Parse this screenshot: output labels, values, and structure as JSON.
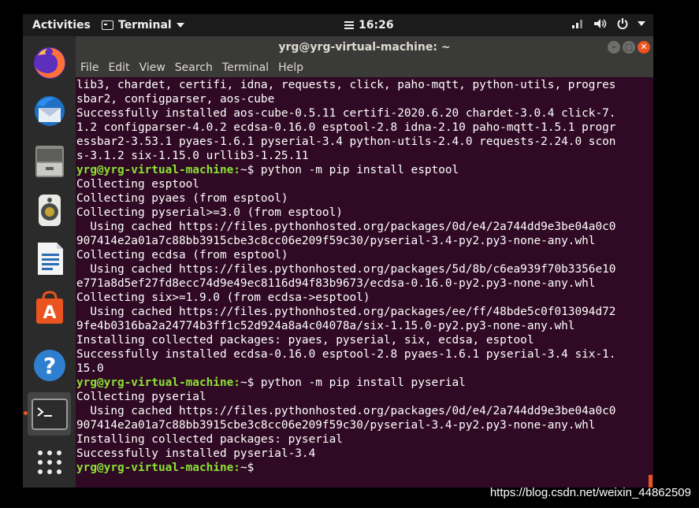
{
  "topbar": {
    "activities": "Activities",
    "app_name": "Terminal",
    "clock": "16:26"
  },
  "window": {
    "title": "yrg@yrg-virtual-machine: ~",
    "buttons": [
      "–",
      "▢",
      "✕"
    ]
  },
  "menubar": {
    "items": [
      "File",
      "Edit",
      "View",
      "Search",
      "Terminal",
      "Help"
    ]
  },
  "terminal": {
    "lines": [
      {
        "text": "lib3, chardet, certifi, idna, requests, click, paho-mqtt, python-utils, progres"
      },
      {
        "text": "sbar2, configparser, aos-cube"
      },
      {
        "text": "Successfully installed aos-cube-0.5.11 certifi-2020.6.20 chardet-3.0.4 click-7."
      },
      {
        "text": "1.2 configparser-4.0.2 ecdsa-0.16.0 esptool-2.8 idna-2.10 paho-mqtt-1.5.1 progr"
      },
      {
        "text": "essbar2-3.53.1 pyaes-1.6.1 pyserial-3.4 python-utils-2.4.0 requests-2.24.0 scon"
      },
      {
        "text": "s-3.1.2 six-1.15.0 urllib3-1.25.11"
      },
      {
        "prompt": "yrg@yrg-virtual-machine:",
        "text": "~$ python -m pip install esptool"
      },
      {
        "text": "Collecting esptool"
      },
      {
        "text": "Collecting pyaes (from esptool)"
      },
      {
        "text": "Collecting pyserial>=3.0 (from esptool)"
      },
      {
        "text": "  Using cached https://files.pythonhosted.org/packages/0d/e4/2a744dd9e3be04a0c0"
      },
      {
        "text": "907414e2a01a7c88bb3915cbe3c8cc06e209f59c30/pyserial-3.4-py2.py3-none-any.whl"
      },
      {
        "text": "Collecting ecdsa (from esptool)"
      },
      {
        "text": "  Using cached https://files.pythonhosted.org/packages/5d/8b/c6ea939f70b3356e10"
      },
      {
        "text": "e771a8d5ef27fd8ecc74d9e49ec8116d94f83b9673/ecdsa-0.16.0-py2.py3-none-any.whl"
      },
      {
        "text": "Collecting six>=1.9.0 (from ecdsa->esptool)"
      },
      {
        "text": "  Using cached https://files.pythonhosted.org/packages/ee/ff/48bde5c0f013094d72"
      },
      {
        "text": "9fe4b0316ba2a24774b3ff1c52d924a8a4c04078a/six-1.15.0-py2.py3-none-any.whl"
      },
      {
        "text": "Installing collected packages: pyaes, pyserial, six, ecdsa, esptool"
      },
      {
        "text": "Successfully installed ecdsa-0.16.0 esptool-2.8 pyaes-1.6.1 pyserial-3.4 six-1."
      },
      {
        "text": "15.0"
      },
      {
        "prompt": "yrg@yrg-virtual-machine:",
        "text": "~$ python -m pip install pyserial"
      },
      {
        "text": "Collecting pyserial"
      },
      {
        "text": "  Using cached https://files.pythonhosted.org/packages/0d/e4/2a744dd9e3be04a0c0"
      },
      {
        "text": "907414e2a01a7c88bb3915cbe3c8cc06e209f59c30/pyserial-3.4-py2.py3-none-any.whl"
      },
      {
        "text": "Installing collected packages: pyserial"
      },
      {
        "text": "Successfully installed pyserial-3.4"
      },
      {
        "prompt": "yrg@yrg-virtual-machine:",
        "text": "~$"
      }
    ]
  },
  "dock": {
    "items": [
      "firefox-icon",
      "thunderbird-icon",
      "files-icon",
      "rhythmbox-icon",
      "writer-icon",
      "software-icon",
      "help-icon",
      "terminal-icon",
      "show-apps-icon"
    ],
    "active": "terminal-icon"
  },
  "watermark": "https://blog.csdn.net/weixin_44862509",
  "colors": {
    "terminal_bg": "#300a24",
    "prompt": "#8ae234",
    "accent": "#e95420"
  }
}
